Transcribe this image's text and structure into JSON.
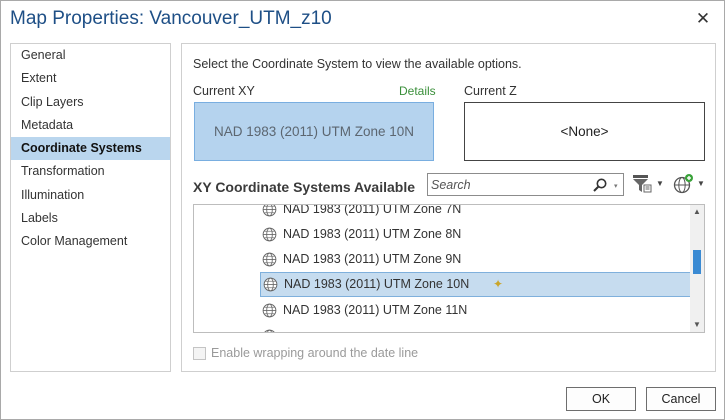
{
  "window": {
    "title": "Map Properties: Vancouver_UTM_z10",
    "close_glyph": "✕"
  },
  "sidebar": {
    "items": [
      {
        "label": "General"
      },
      {
        "label": "Extent"
      },
      {
        "label": "Clip Layers"
      },
      {
        "label": "Metadata"
      },
      {
        "label": "Coordinate Systems",
        "active": true
      },
      {
        "label": "Transformation"
      },
      {
        "label": "Illumination"
      },
      {
        "label": "Labels"
      },
      {
        "label": "Color Management"
      }
    ]
  },
  "main": {
    "instruction": "Select the Coordinate System to view the available options.",
    "current_xy_label": "Current XY",
    "details_label": "Details",
    "current_z_label": "Current Z",
    "current_xy_value": "NAD 1983 (2011) UTM Zone 10N",
    "current_z_value": "<None>",
    "available_heading": "XY Coordinate Systems Available",
    "search": {
      "placeholder": "Search",
      "value": ""
    },
    "list": {
      "partial_top": "NAD 1983 (2011) UTM Zone  7N",
      "rows": [
        {
          "label": "NAD 1983 (2011) UTM Zone  8N"
        },
        {
          "label": "NAD 1983 (2011) UTM Zone  9N"
        },
        {
          "label": "NAD 1983 (2011) UTM Zone 10N",
          "selected": true
        },
        {
          "label": "NAD 1983 (2011) UTM Zone 11N"
        }
      ]
    },
    "wrap_label": "Enable wrapping around the date line",
    "wrap_checked": false
  },
  "footer": {
    "ok_label": "OK",
    "cancel_label": "Cancel"
  },
  "icons": {
    "globe": "globe-icon",
    "search": "search-icon",
    "filter": "filter-icon",
    "add_globe": "add-globe-icon",
    "pin": "favorite-pin-icon"
  },
  "colors": {
    "title": "#1e4f86",
    "selection": "#bad6ee",
    "details_link": "#3a8f3a",
    "scroll_thumb": "#3a8ad3"
  }
}
